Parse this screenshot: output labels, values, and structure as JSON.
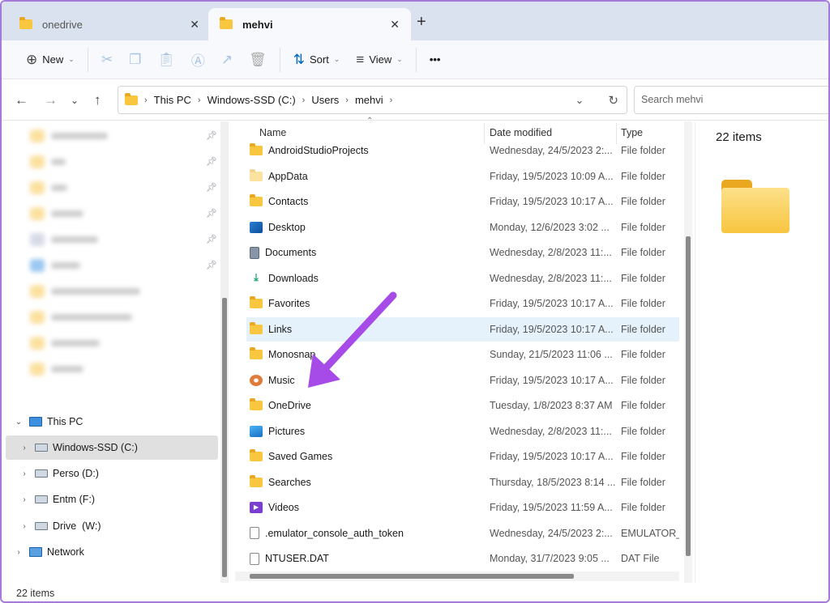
{
  "tabs": [
    {
      "label": "onedrive",
      "active": false
    },
    {
      "label": "mehvi",
      "active": true
    }
  ],
  "new_tab_label": "+",
  "toolbar": {
    "new": "New",
    "sort": "Sort",
    "view": "View",
    "more": "•••"
  },
  "breadcrumb": [
    "This PC",
    "Windows-SSD (C:)",
    "Users",
    "mehvi"
  ],
  "search": {
    "placeholder": "Search mehvi"
  },
  "nav_tree": [
    {
      "label": "This PC",
      "expanded": true
    },
    {
      "label": "Windows-SSD (C:)",
      "selected": true
    },
    {
      "label": "Perso (D:)"
    },
    {
      "label": "Entm (F:)"
    },
    {
      "label": "Drive  (W:)"
    },
    {
      "label": "Network"
    }
  ],
  "columns": {
    "name": "Name",
    "date": "Date modified",
    "type": "Type"
  },
  "files": [
    {
      "name": "AndroidStudioProjects",
      "date": "Wednesday, 24/5/2023 2:...",
      "type": "File folder",
      "icon": "folder"
    },
    {
      "name": "AppData",
      "date": "Friday, 19/5/2023 10:09 A...",
      "type": "File folder",
      "icon": "folder-hidden"
    },
    {
      "name": "Contacts",
      "date": "Friday, 19/5/2023 10:17 A...",
      "type": "File folder",
      "icon": "folder"
    },
    {
      "name": "Desktop",
      "date": "Monday, 12/6/2023 3:02 ...",
      "type": "File folder",
      "icon": "desktop"
    },
    {
      "name": "Documents",
      "date": "Wednesday, 2/8/2023 11:...",
      "type": "File folder",
      "icon": "documents"
    },
    {
      "name": "Downloads",
      "date": "Wednesday, 2/8/2023 11:...",
      "type": "File folder",
      "icon": "downloads"
    },
    {
      "name": "Favorites",
      "date": "Friday, 19/5/2023 10:17 A...",
      "type": "File folder",
      "icon": "folder"
    },
    {
      "name": "Links",
      "date": "Friday, 19/5/2023 10:17 A...",
      "type": "File folder",
      "icon": "folder",
      "selected": true
    },
    {
      "name": "Monosnap",
      "date": "Sunday, 21/5/2023 11:06 ...",
      "type": "File folder",
      "icon": "folder"
    },
    {
      "name": "Music",
      "date": "Friday, 19/5/2023 10:17 A...",
      "type": "File folder",
      "icon": "music"
    },
    {
      "name": "OneDrive",
      "date": "Tuesday, 1/8/2023 8:37 AM",
      "type": "File folder",
      "icon": "folder"
    },
    {
      "name": "Pictures",
      "date": "Wednesday, 2/8/2023 11:...",
      "type": "File folder",
      "icon": "pictures"
    },
    {
      "name": "Saved Games",
      "date": "Friday, 19/5/2023 10:17 A...",
      "type": "File folder",
      "icon": "folder"
    },
    {
      "name": "Searches",
      "date": "Thursday, 18/5/2023 8:14 ...",
      "type": "File folder",
      "icon": "folder"
    },
    {
      "name": "Videos",
      "date": "Friday, 19/5/2023 11:59 A...",
      "type": "File folder",
      "icon": "videos"
    },
    {
      "name": ".emulator_console_auth_token",
      "date": "Wednesday, 24/5/2023 2:...",
      "type": "EMULATOR_C",
      "icon": "file"
    },
    {
      "name": "NTUSER.DAT",
      "date": "Monday, 31/7/2023 9:05 ...",
      "type": "DAT File",
      "icon": "file"
    }
  ],
  "details": {
    "count": "22 items"
  },
  "status": {
    "count": "22 items"
  },
  "colors": {
    "accent": "#0067c0",
    "arrow": "#a64ae8",
    "folder": "#f8c63f"
  }
}
